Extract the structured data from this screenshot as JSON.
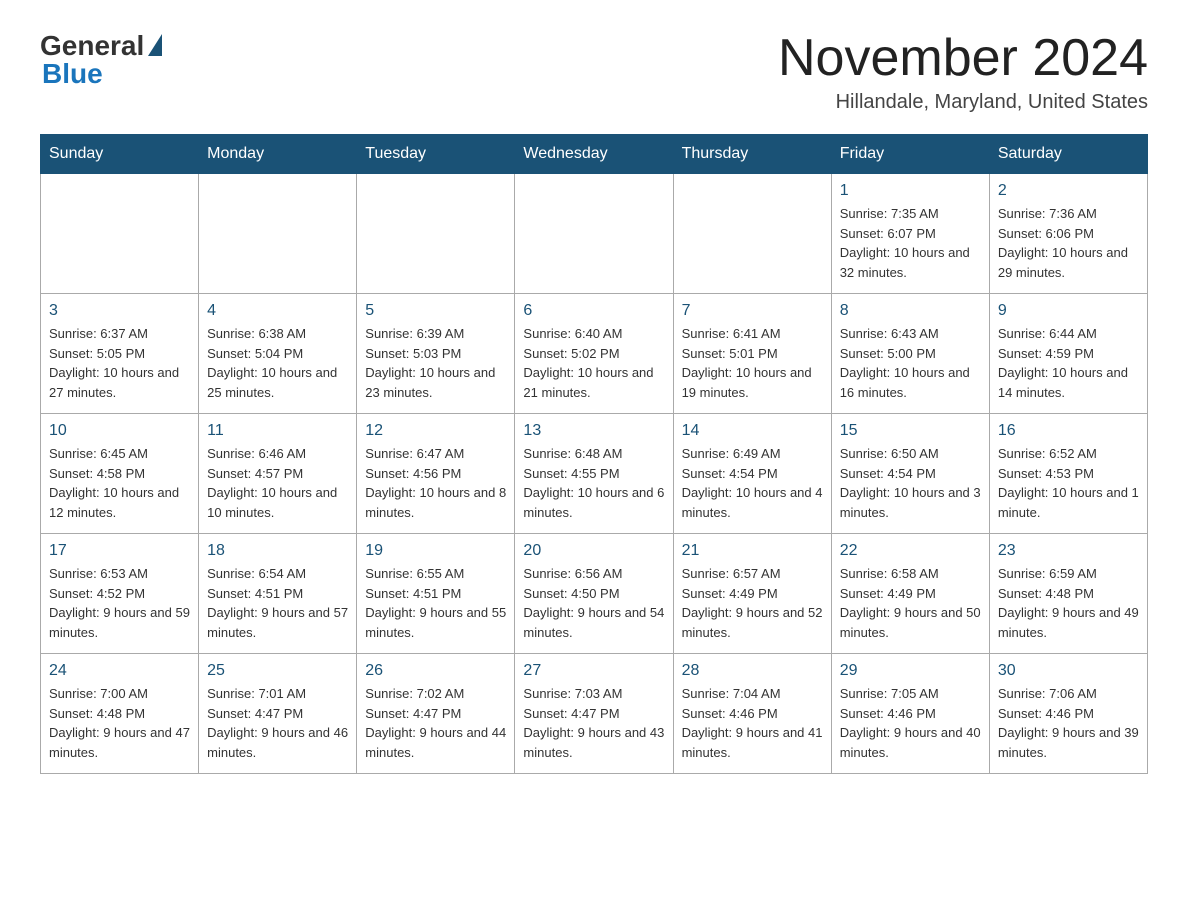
{
  "logo": {
    "general": "General",
    "blue": "Blue"
  },
  "title": "November 2024",
  "location": "Hillandale, Maryland, United States",
  "days_of_week": [
    "Sunday",
    "Monday",
    "Tuesday",
    "Wednesday",
    "Thursday",
    "Friday",
    "Saturday"
  ],
  "weeks": [
    [
      {
        "day": "",
        "info": ""
      },
      {
        "day": "",
        "info": ""
      },
      {
        "day": "",
        "info": ""
      },
      {
        "day": "",
        "info": ""
      },
      {
        "day": "",
        "info": ""
      },
      {
        "day": "1",
        "info": "Sunrise: 7:35 AM\nSunset: 6:07 PM\nDaylight: 10 hours and 32 minutes."
      },
      {
        "day": "2",
        "info": "Sunrise: 7:36 AM\nSunset: 6:06 PM\nDaylight: 10 hours and 29 minutes."
      }
    ],
    [
      {
        "day": "3",
        "info": "Sunrise: 6:37 AM\nSunset: 5:05 PM\nDaylight: 10 hours and 27 minutes."
      },
      {
        "day": "4",
        "info": "Sunrise: 6:38 AM\nSunset: 5:04 PM\nDaylight: 10 hours and 25 minutes."
      },
      {
        "day": "5",
        "info": "Sunrise: 6:39 AM\nSunset: 5:03 PM\nDaylight: 10 hours and 23 minutes."
      },
      {
        "day": "6",
        "info": "Sunrise: 6:40 AM\nSunset: 5:02 PM\nDaylight: 10 hours and 21 minutes."
      },
      {
        "day": "7",
        "info": "Sunrise: 6:41 AM\nSunset: 5:01 PM\nDaylight: 10 hours and 19 minutes."
      },
      {
        "day": "8",
        "info": "Sunrise: 6:43 AM\nSunset: 5:00 PM\nDaylight: 10 hours and 16 minutes."
      },
      {
        "day": "9",
        "info": "Sunrise: 6:44 AM\nSunset: 4:59 PM\nDaylight: 10 hours and 14 minutes."
      }
    ],
    [
      {
        "day": "10",
        "info": "Sunrise: 6:45 AM\nSunset: 4:58 PM\nDaylight: 10 hours and 12 minutes."
      },
      {
        "day": "11",
        "info": "Sunrise: 6:46 AM\nSunset: 4:57 PM\nDaylight: 10 hours and 10 minutes."
      },
      {
        "day": "12",
        "info": "Sunrise: 6:47 AM\nSunset: 4:56 PM\nDaylight: 10 hours and 8 minutes."
      },
      {
        "day": "13",
        "info": "Sunrise: 6:48 AM\nSunset: 4:55 PM\nDaylight: 10 hours and 6 minutes."
      },
      {
        "day": "14",
        "info": "Sunrise: 6:49 AM\nSunset: 4:54 PM\nDaylight: 10 hours and 4 minutes."
      },
      {
        "day": "15",
        "info": "Sunrise: 6:50 AM\nSunset: 4:54 PM\nDaylight: 10 hours and 3 minutes."
      },
      {
        "day": "16",
        "info": "Sunrise: 6:52 AM\nSunset: 4:53 PM\nDaylight: 10 hours and 1 minute."
      }
    ],
    [
      {
        "day": "17",
        "info": "Sunrise: 6:53 AM\nSunset: 4:52 PM\nDaylight: 9 hours and 59 minutes."
      },
      {
        "day": "18",
        "info": "Sunrise: 6:54 AM\nSunset: 4:51 PM\nDaylight: 9 hours and 57 minutes."
      },
      {
        "day": "19",
        "info": "Sunrise: 6:55 AM\nSunset: 4:51 PM\nDaylight: 9 hours and 55 minutes."
      },
      {
        "day": "20",
        "info": "Sunrise: 6:56 AM\nSunset: 4:50 PM\nDaylight: 9 hours and 54 minutes."
      },
      {
        "day": "21",
        "info": "Sunrise: 6:57 AM\nSunset: 4:49 PM\nDaylight: 9 hours and 52 minutes."
      },
      {
        "day": "22",
        "info": "Sunrise: 6:58 AM\nSunset: 4:49 PM\nDaylight: 9 hours and 50 minutes."
      },
      {
        "day": "23",
        "info": "Sunrise: 6:59 AM\nSunset: 4:48 PM\nDaylight: 9 hours and 49 minutes."
      }
    ],
    [
      {
        "day": "24",
        "info": "Sunrise: 7:00 AM\nSunset: 4:48 PM\nDaylight: 9 hours and 47 minutes."
      },
      {
        "day": "25",
        "info": "Sunrise: 7:01 AM\nSunset: 4:47 PM\nDaylight: 9 hours and 46 minutes."
      },
      {
        "day": "26",
        "info": "Sunrise: 7:02 AM\nSunset: 4:47 PM\nDaylight: 9 hours and 44 minutes."
      },
      {
        "day": "27",
        "info": "Sunrise: 7:03 AM\nSunset: 4:47 PM\nDaylight: 9 hours and 43 minutes."
      },
      {
        "day": "28",
        "info": "Sunrise: 7:04 AM\nSunset: 4:46 PM\nDaylight: 9 hours and 41 minutes."
      },
      {
        "day": "29",
        "info": "Sunrise: 7:05 AM\nSunset: 4:46 PM\nDaylight: 9 hours and 40 minutes."
      },
      {
        "day": "30",
        "info": "Sunrise: 7:06 AM\nSunset: 4:46 PM\nDaylight: 9 hours and 39 minutes."
      }
    ]
  ]
}
